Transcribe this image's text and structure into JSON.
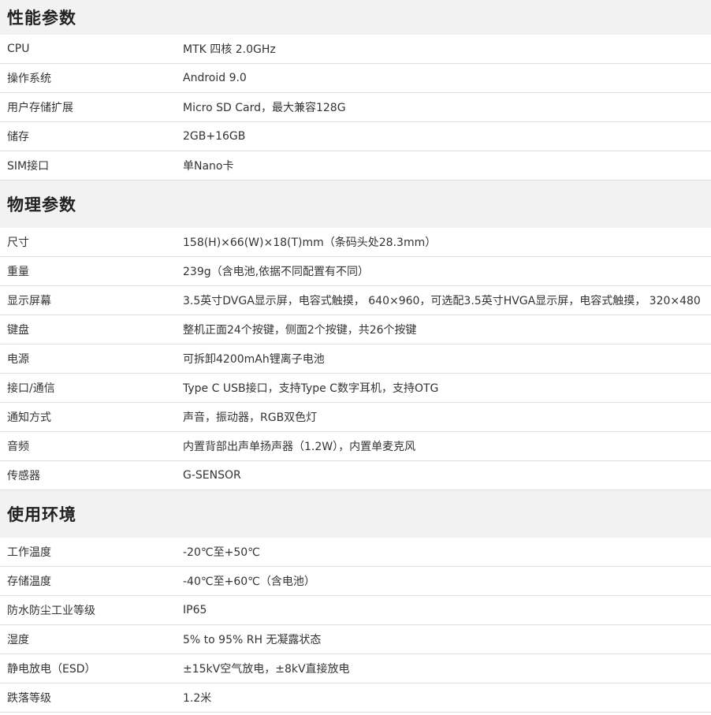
{
  "sections": [
    {
      "title": "性能参数",
      "rows": [
        {
          "label": "CPU",
          "value": "MTK 四核 2.0GHz"
        },
        {
          "label": "操作系统",
          "value": "Android 9.0"
        },
        {
          "label": "用户存储扩展",
          "value": "Micro SD Card，最大兼容128G"
        },
        {
          "label": "储存",
          "value": "2GB+16GB"
        },
        {
          "label": "SIM接口",
          "value": "单Nano卡"
        }
      ]
    },
    {
      "title": "物理参数",
      "rows": [
        {
          "label": "尺寸",
          "value": "158(H)×66(W)×18(T)mm（条码头处28.3mm）"
        },
        {
          "label": "重量",
          "value": "239g（含电池,依据不同配置有不同）"
        },
        {
          "label": "显示屏幕",
          "value": "3.5英寸DVGA显示屏，电容式触摸， 640×960，可选配3.5英寸HVGA显示屏，电容式触摸， 320×480"
        },
        {
          "label": "键盘",
          "value": "整机正面24个按键，侧面2个按键，共26个按键"
        },
        {
          "label": "电源",
          "value": "可拆卸4200mAh锂离子电池"
        },
        {
          "label": "接口/通信",
          "value": "Type C USB接口，支持Type C数字耳机，支持OTG"
        },
        {
          "label": "通知方式",
          "value": "声音，振动器，RGB双色灯"
        },
        {
          "label": "音频",
          "value": "内置背部出声单扬声器（1.2W），内置单麦克风"
        },
        {
          "label": "传感器",
          "value": "G-SENSOR"
        }
      ]
    },
    {
      "title": "使用环境",
      "rows": [
        {
          "label": "工作温度",
          "value": "-20℃至+50℃"
        },
        {
          "label": "存储温度",
          "value": "-40℃至+60℃（含电池）"
        },
        {
          "label": "防水防尘工业等级",
          "value": "IP65"
        },
        {
          "label": "湿度",
          "value": "5% to 95% RH 无凝露状态"
        },
        {
          "label": "静电放电（ESD）",
          "value": "±15kV空气放电，±8kV直接放电"
        },
        {
          "label": "跌落等级",
          "value": "1.2米"
        }
      ]
    }
  ]
}
